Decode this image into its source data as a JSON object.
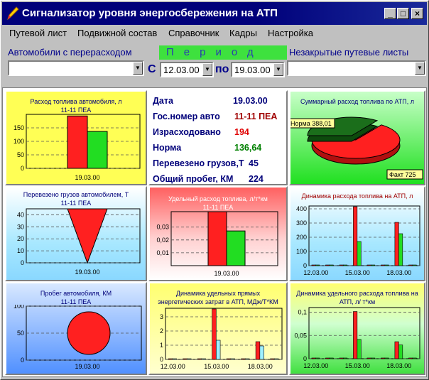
{
  "window": {
    "title": "Сигнализатор уровня энергосбережения на АТП",
    "min": "_",
    "max": "□",
    "close": "×"
  },
  "menu": [
    "Путевой лист",
    "Подвижной состав",
    "Справочник",
    "Кадры",
    "Настройка"
  ],
  "filters": {
    "cars_label": "Автомобили с перерасходом",
    "cars_value": "",
    "period_label": "Период",
    "from_label": "С",
    "from_value": "12.03.00",
    "to_label": "по",
    "to_value": "19.03.00",
    "open_sheets_label": "Незакрытые путевые листы",
    "open_sheets_value": ""
  },
  "info": {
    "rows": [
      {
        "label": "Дата",
        "value": "19.03.00",
        "color": "#00007a"
      },
      {
        "label": "Гос.номер авто",
        "value": "11-11 ПЕА",
        "color": "#a00000"
      },
      {
        "label": "Израсходовано",
        "value": "194",
        "color": "#e00000"
      },
      {
        "label": "Норма",
        "value": "136,64",
        "color": "#008000"
      },
      {
        "label": "Перевезено грузов,Т",
        "value": "45",
        "color": "#00007a"
      },
      {
        "label": "Общий пробег, КМ",
        "value": "224",
        "color": "#00007a"
      }
    ]
  },
  "colors": {
    "red": "#ff2020",
    "green": "#22dd22",
    "cyan": "#a0f0ff",
    "darkgreen": "#1b6e1b",
    "navy": "#00007a"
  },
  "chart_data": [
    {
      "id": "fuel",
      "type": "bar",
      "title": "Расход топлива автомобиля, л",
      "subtitle": "11-11 ПЕА",
      "categories": [
        "19.03.00"
      ],
      "series": [
        {
          "values": [
            194
          ]
        },
        {
          "values": [
            136.64
          ]
        }
      ],
      "yticks": [
        0,
        50,
        100,
        150
      ],
      "ylim": [
        0,
        200
      ]
    },
    {
      "id": "cargo",
      "type": "bar",
      "title": "Перевезено грузов автомобилем, Т",
      "subtitle": "11-11 ПЕА",
      "categories": [
        "19.03.00"
      ],
      "series": [
        {
          "values": [
            45
          ]
        }
      ],
      "yticks": [
        0,
        10,
        20,
        30,
        40
      ],
      "ylim": [
        0,
        45
      ]
    },
    {
      "id": "mileage",
      "type": "bar",
      "title": "Пробег автомобиля, КМ",
      "subtitle": "11-11 ПЕА",
      "categories": [
        "19.03.00"
      ],
      "series": [
        {
          "values": [
            224
          ]
        }
      ],
      "yticks": [
        0,
        50,
        100
      ],
      "ylim": [
        0,
        100
      ]
    },
    {
      "id": "specific",
      "type": "bar",
      "title": "Удельный расход топлива, л/т*км",
      "subtitle": "11-11 ПЕА",
      "categories": [
        "19.03.00"
      ],
      "series": [
        {
          "values": [
            0.042
          ]
        },
        {
          "values": [
            0.027
          ]
        }
      ],
      "yticks": [
        "0,01",
        "0,02",
        "0,03"
      ],
      "ylim": [
        0,
        0.042
      ]
    },
    {
      "id": "pie",
      "type": "pie",
      "title": "Суммарный расход топлива по АТП, л",
      "slices": [
        {
          "label": "Норма 388,01",
          "value": 388.01
        },
        {
          "label": "Факт 725",
          "value": 725
        }
      ]
    },
    {
      "id": "dyn_fuel",
      "type": "bar",
      "title": "Динамика расхода топлива  на АТП, л",
      "categories": [
        "12.03.00",
        "15.03.00",
        "18.03.00"
      ],
      "series": [
        {
          "values": [
            0,
            0,
            0,
            410,
            0,
            0,
            300,
            0
          ]
        },
        {
          "values": [
            0,
            0,
            0,
            165,
            0,
            0,
            220,
            0
          ]
        }
      ],
      "yticks": [
        0,
        100,
        200,
        300,
        400
      ],
      "ylim": [
        0,
        420
      ]
    },
    {
      "id": "dyn_energy",
      "type": "bar",
      "title": "Динамика удельных прямых энергетических  затрат в АТП, МДж/Т*КМ",
      "categories": [
        "12.03.00",
        "15.03.00",
        "18.03.00"
      ],
      "series": [
        {
          "values": [
            0,
            0,
            0,
            3.5,
            0,
            0,
            1.2,
            0
          ]
        },
        {
          "values": [
            0,
            0,
            0,
            1.3,
            0,
            0,
            0.9,
            0
          ]
        }
      ],
      "yticks": [
        0,
        1,
        2,
        3
      ],
      "ylim": [
        0,
        3.6
      ]
    },
    {
      "id": "dyn_specific",
      "type": "bar",
      "title": "Динамика удельного расхода топлива на АТП, л/ т*км",
      "categories": [
        "12.03.00",
        "15.03.00",
        "18.03.00"
      ],
      "series": [
        {
          "values": [
            0,
            0,
            0,
            0.1,
            0,
            0,
            0.035,
            0
          ]
        },
        {
          "values": [
            0,
            0,
            0,
            0.04,
            0,
            0,
            0.028,
            0
          ]
        }
      ],
      "yticks": [
        "0",
        "0,05",
        "0,1"
      ],
      "ylim": [
        0,
        0.11
      ]
    }
  ]
}
